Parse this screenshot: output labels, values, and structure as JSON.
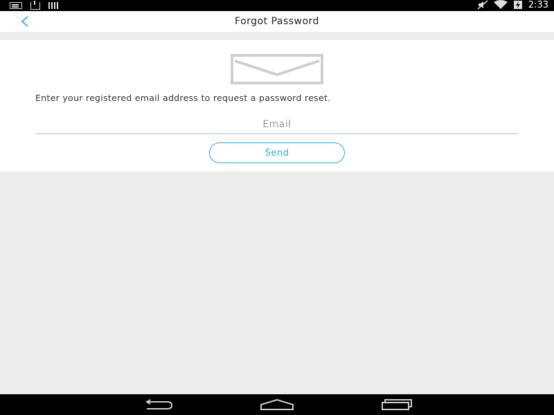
{
  "status_bar": {
    "time": "2:33",
    "left_icons": [
      "message-icon",
      "download-icon",
      "signal-bars-icon"
    ],
    "right_icons": [
      "mute-icon",
      "wifi-icon",
      "battery-icon"
    ]
  },
  "header": {
    "title": "Forgot Password",
    "back_icon": "chevron-left-icon",
    "accent_color": "#29a8e0"
  },
  "form": {
    "icon": "envelope-icon",
    "instruction": "Enter your registered email address to request a password reset.",
    "email_placeholder": "Email",
    "email_value": "",
    "send_label": "Send"
  },
  "nav_bar": {
    "buttons": [
      "back-icon",
      "home-icon",
      "recents-icon"
    ]
  }
}
